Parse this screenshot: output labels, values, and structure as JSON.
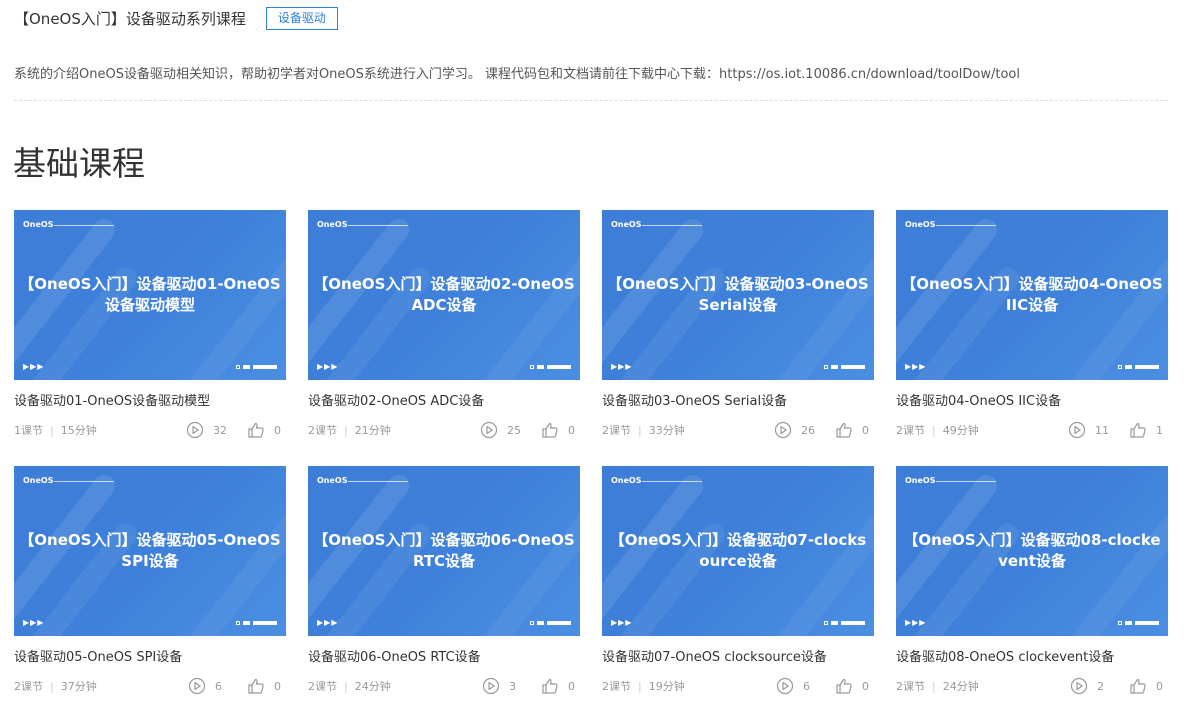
{
  "header": {
    "title": "【OneOS入门】设备驱动系列课程",
    "tag_label": "设备驱动"
  },
  "description": "系统的介绍OneOS设备驱动相关知识，帮助初学者对OneOS系统进行入门学习。 课程代码包和文档请前往下载中心下载：https://os.iot.10086.cn/download/toolDow/tool",
  "section_title": "基础课程",
  "colors": {
    "accent": "#2d7fe0",
    "thumb_blue": "#3f7ed8"
  },
  "icons": {
    "views": "play-circle-icon",
    "likes": "thumbs-up-icon"
  },
  "courses": [
    {
      "brand": "OneOS",
      "thumb_title": "【OneOS入门】设备驱动01-OneOS设备驱动模型",
      "name": "设备驱动01-OneOS设备驱动模型",
      "lessons": "1课节",
      "duration": "15分钟",
      "views": "32",
      "likes": "0"
    },
    {
      "brand": "OneOS",
      "thumb_title": "【OneOS入门】设备驱动02-OneOS ADC设备",
      "name": "设备驱动02-OneOS ADC设备",
      "lessons": "2课节",
      "duration": "21分钟",
      "views": "25",
      "likes": "0"
    },
    {
      "brand": "OneOS",
      "thumb_title": "【OneOS入门】设备驱动03-OneOS Serial设备",
      "name": "设备驱动03-OneOS Serial设备",
      "lessons": "2课节",
      "duration": "33分钟",
      "views": "26",
      "likes": "0"
    },
    {
      "brand": "OneOS",
      "thumb_title": "【OneOS入门】设备驱动04-OneOS IIC设备",
      "name": "设备驱动04-OneOS IIC设备",
      "lessons": "2课节",
      "duration": "49分钟",
      "views": "11",
      "likes": "1"
    },
    {
      "brand": "OneOS",
      "thumb_title": "【OneOS入门】设备驱动05-OneOS SPI设备",
      "name": "设备驱动05-OneOS SPI设备",
      "lessons": "2课节",
      "duration": "37分钟",
      "views": "6",
      "likes": "0"
    },
    {
      "brand": "OneOS",
      "thumb_title": "【OneOS入门】设备驱动06-OneOS RTC设备",
      "name": "设备驱动06-OneOS RTC设备",
      "lessons": "2课节",
      "duration": "24分钟",
      "views": "3",
      "likes": "0"
    },
    {
      "brand": "OneOS",
      "thumb_title": "【OneOS入门】设备驱动07-clocksource设备",
      "name": "设备驱动07-OneOS clocksource设备",
      "lessons": "2课节",
      "duration": "19分钟",
      "views": "6",
      "likes": "0"
    },
    {
      "brand": "OneOS",
      "thumb_title": "【OneOS入门】设备驱动08-clockevent设备",
      "name": "设备驱动08-OneOS clockevent设备",
      "lessons": "2课节",
      "duration": "24分钟",
      "views": "2",
      "likes": "0"
    }
  ]
}
